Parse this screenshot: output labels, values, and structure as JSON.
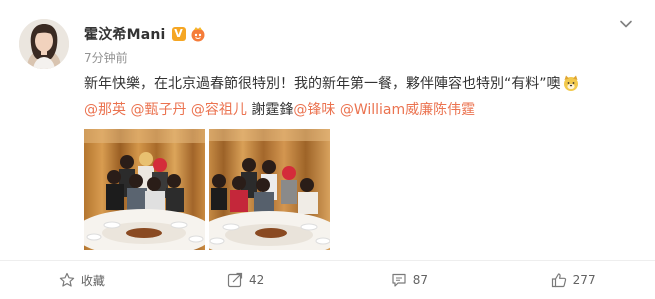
{
  "post": {
    "username": "霍汶希Mani",
    "verified_badge": "V",
    "time": "7分钟前",
    "text_line1": "新年快樂，在北京過春節很特別！我的新年第一餐，夥伴陣容也特別“有料”噢",
    "mentions": [
      {
        "text": "@那英",
        "type": "mention"
      },
      {
        "text": "@甄子丹",
        "type": "mention"
      },
      {
        "text": "@容祖儿",
        "type": "mention"
      },
      {
        "text": "謝霆鋒",
        "type": "plain"
      },
      {
        "text": "@锋味",
        "type": "mention"
      },
      {
        "text": "@William威廉陈伟霆",
        "type": "mention"
      }
    ]
  },
  "actions": {
    "favorite": {
      "label": "收藏",
      "icon": "star-icon"
    },
    "repost": {
      "count": "42",
      "icon": "share-icon"
    },
    "comment": {
      "count": "87",
      "icon": "comment-icon"
    },
    "like": {
      "count": "277",
      "icon": "thumbs-up-icon"
    }
  },
  "colors": {
    "mention": "#eb7350",
    "text": "#333333",
    "meta": "#939393",
    "verified": "#f5a623"
  }
}
